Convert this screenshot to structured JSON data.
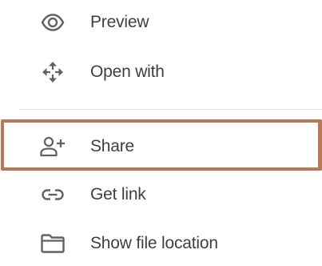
{
  "menu": {
    "items": [
      {
        "id": "preview",
        "label": "Preview",
        "icon": "eye-icon"
      },
      {
        "id": "open-with",
        "label": "Open with",
        "icon": "move-arrows-icon"
      },
      {
        "id": "share",
        "label": "Share",
        "icon": "add-person-icon",
        "highlighted": true
      },
      {
        "id": "get-link",
        "label": "Get link",
        "icon": "link-icon"
      },
      {
        "id": "show-file-location",
        "label": "Show file location",
        "icon": "folder-icon"
      }
    ]
  },
  "colors": {
    "text": "#3c4043",
    "icon": "#5f6368",
    "divider": "#dadce0",
    "highlight_border": "#b87a56"
  }
}
